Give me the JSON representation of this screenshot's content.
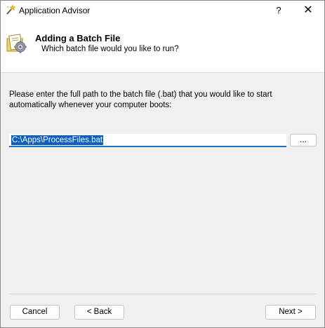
{
  "window": {
    "title": "Application Advisor",
    "help_glyph": "?",
    "close_glyph": "✕",
    "app_icon": "magic-wand-icon"
  },
  "header": {
    "icon": "batch-file-gear-icon",
    "title": "Adding a Batch File",
    "subtitle": "Which batch file would you like to run?"
  },
  "main": {
    "instructions": "Please enter the full path to the batch file (.bat) that you would like to start automatically whenever your computer boots:",
    "path_value": "C:\\Apps\\ProcessFiles.bat",
    "browse_label": "..."
  },
  "footer": {
    "cancel_label": "Cancel",
    "back_label": "< Back",
    "next_label": "Next >"
  },
  "colors": {
    "selection": "#0a5fc4",
    "focus_underline": "#1a6fc9",
    "dialog_background": "#f0f0f0"
  }
}
